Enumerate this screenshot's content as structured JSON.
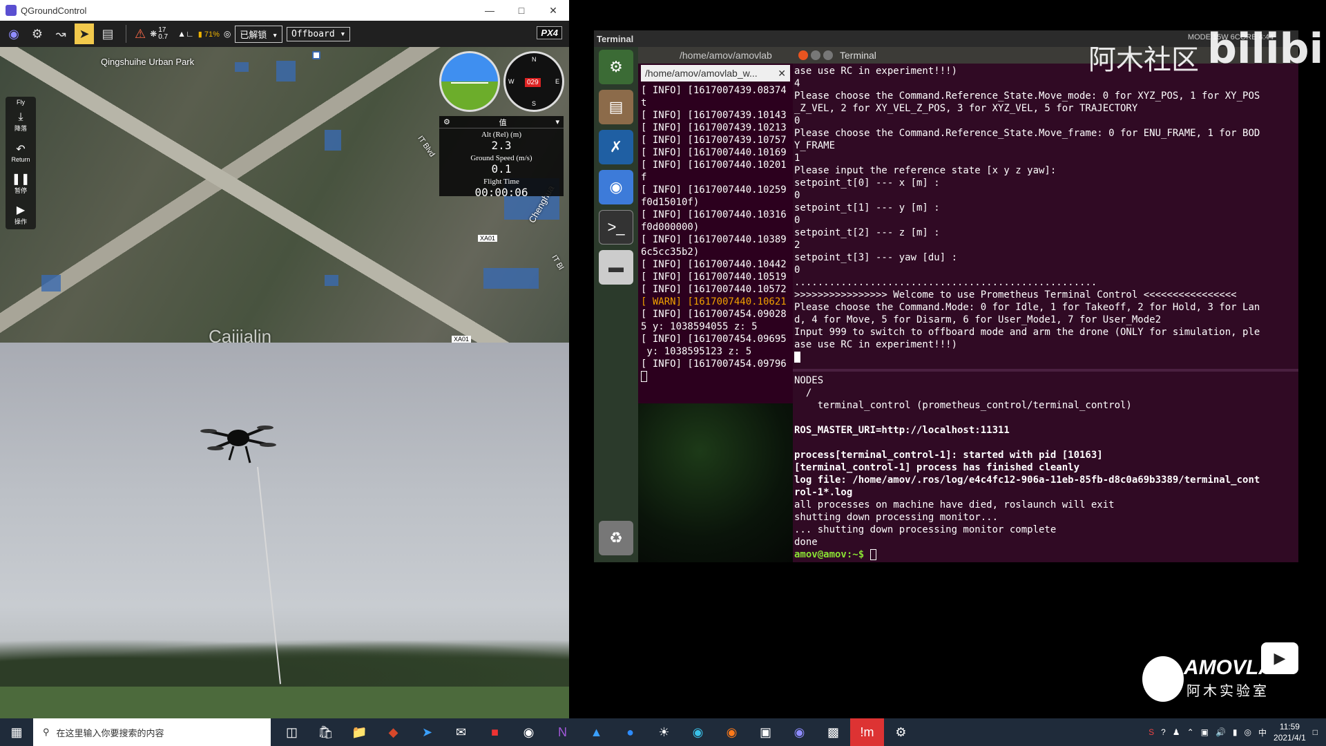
{
  "qgc": {
    "window_title": "QGroundControl",
    "toolbar": {
      "satellite_count": "17",
      "hdop": "0.7",
      "battery": "71%",
      "arm_state": "已解锁",
      "flight_mode": "Offboard",
      "brand": "PX4"
    },
    "fly_panel": {
      "header": "Fly",
      "items": [
        {
          "label": "降落",
          "icon": "land-icon"
        },
        {
          "label": "Return",
          "icon": "return-icon"
        },
        {
          "label": "暂停",
          "icon": "pause-icon"
        },
        {
          "label": "操作",
          "icon": "play-icon"
        }
      ]
    },
    "map": {
      "labels": [
        "Qingshuihe Urban Park",
        "IT Blvd",
        "Chenghua",
        "IT Bl",
        "Caijialin"
      ],
      "tags": [
        "XA01",
        "XA01"
      ]
    },
    "instruments": {
      "heading": "029",
      "values_header": "值",
      "alt_label": "Alt (Rel) (m)",
      "alt_value": "2.3",
      "speed_label": "Ground Speed (m/s)",
      "speed_value": "0.1",
      "time_label": "Flight Time",
      "time_value": "00:00:06"
    }
  },
  "ubuntu": {
    "topbar_title": "Terminal",
    "topbar_sys": "MODE 15W 6CORE    4:44",
    "term1": {
      "title": "/home/amov/amovlab",
      "tab": "/home/amov/amovlab_w...",
      "lines": [
        "[ INFO] [1617007439.08374",
        "t",
        "[ INFO] [1617007439.10143",
        "[ INFO] [1617007439.10213",
        "[ INFO] [1617007439.10757",
        "[ INFO] [1617007440.10169",
        "[ INFO] [1617007440.10201",
        "f",
        "[ INFO] [1617007440.10259",
        "f0d15010f)",
        "[ INFO] [1617007440.10316",
        "f0d000000)",
        "[ INFO] [1617007440.10389",
        "6c5cc35b2)",
        "[ INFO] [1617007440.10442",
        "[ INFO] [1617007440.10519",
        "[ INFO] [1617007440.10572",
        "[ WARN] [1617007440.10621",
        "[ INFO] [1617007454.09028",
        "5 y: 1038594055 z: 5",
        "[ INFO] [1617007454.09695",
        " y: 1038595123 z: 5",
        "[ INFO] [1617007454.09796"
      ]
    },
    "term2": {
      "title": "Terminal",
      "lines": [
        "ase use RC in experiment!!!)",
        "4",
        "Please choose the Command.Reference_State.Move_mode: 0 for XYZ_POS, 1 for XY_POS",
        "_Z_VEL, 2 for XY_VEL_Z_POS, 3 for XYZ_VEL, 5 for TRAJECTORY",
        "0",
        "Please choose the Command.Reference_State.Move_frame: 0 for ENU_FRAME, 1 for BOD",
        "Y_FRAME",
        "1",
        "Please input the reference state [x y z yaw]:",
        "setpoint_t[0] --- x [m] :",
        "0",
        "setpoint_t[1] --- y [m] :",
        "0",
        "setpoint_t[2] --- z [m] :",
        "2",
        "setpoint_t[3] --- yaw [du] :",
        "0",
        "....................................................",
        ">>>>>>>>>>>>>>>> Welcome to use Prometheus Terminal Control <<<<<<<<<<<<<<<<",
        "Please choose the Command.Mode: 0 for Idle, 1 for Takeoff, 2 for Hold, 3 for Lan",
        "d, 4 for Move, 5 for Disarm, 6 for User_Mode1, 7 for User_Mode2",
        "Input 999 to switch to offboard mode and arm the drone (ONLY for simulation, ple",
        "ase use RC in experiment!!!)"
      ],
      "lower_lines": [
        "NODES",
        "  /",
        "    terminal_control (prometheus_control/terminal_control)",
        "",
        "ROS_MASTER_URI=http://localhost:11311",
        "",
        "process[terminal_control-1]: started with pid [10163]",
        "[terminal_control-1] process has finished cleanly",
        "log file: /home/amov/.ros/log/e4c4fc12-906a-11eb-85fb-d8c0a69b3389/terminal_cont",
        "rol-1*.log",
        "all processes on machine have died, roslaunch will exit",
        "shutting down processing monitor...",
        "... shutting down processing monitor complete",
        "done"
      ],
      "prompt": "amov@amov:~$"
    }
  },
  "watermarks": {
    "community": "阿木社区",
    "bilibili": "bilibili",
    "amovlab_en": "AMOVLAB",
    "amovlab_cn": "阿木实验室"
  },
  "taskbar": {
    "search_placeholder": "在这里输入你要搜索的内容",
    "time": "11:59",
    "date": "2021/4/1"
  },
  "colors": {
    "terminal_bg": "#300a24",
    "prompt": "#8ae234",
    "warn": "#f0a000",
    "qgc_active": "#f2c94c"
  }
}
